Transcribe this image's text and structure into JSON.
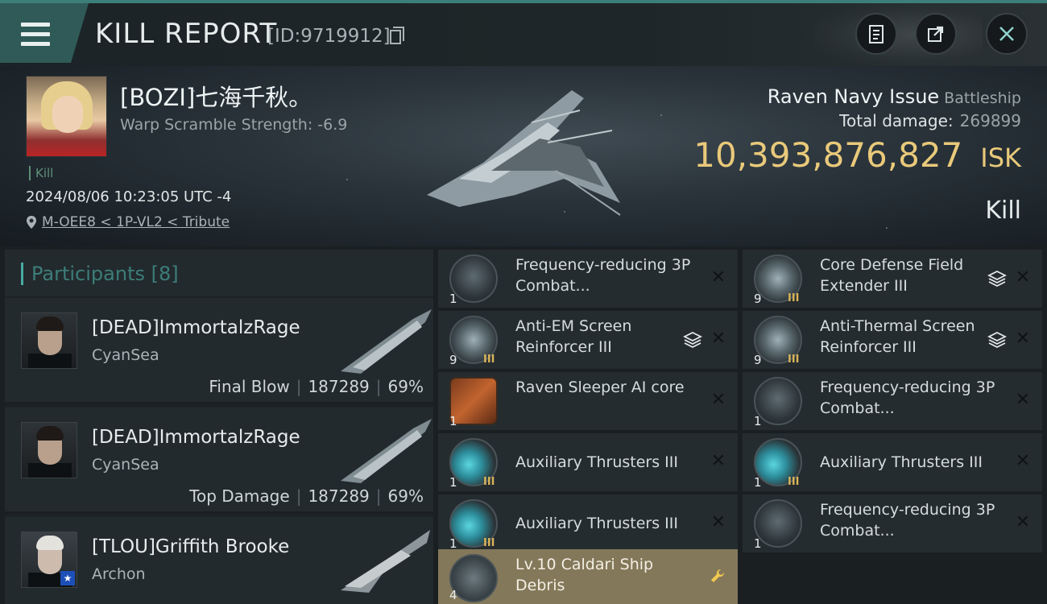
{
  "header": {
    "title": "KILL REPORT",
    "kill_id": "[ID:9719912]",
    "icons": [
      "menu-icon",
      "copy-icon",
      "clipboard-icon",
      "share-icon",
      "close-icon"
    ]
  },
  "victim": {
    "name": "[BOZI]七海千秋。",
    "warp_scramble": "Warp Scramble Strength: -6.9",
    "kill_tag": "Kill",
    "timestamp": "2024/08/06 10:23:05 UTC -4",
    "location": "M-OEE8 < 1P-VL2 < Tribute",
    "ship_name": "Raven Navy Issue",
    "ship_class": "Battleship",
    "total_damage_label": "Total damage:",
    "total_damage_value": "269899",
    "isk_value": "10,393,876,827",
    "isk_unit": "ISK",
    "result": "Kill"
  },
  "participants": {
    "title": "Participants",
    "count": "[8]",
    "rows": [
      {
        "name": "[DEAD]ImmortalzRage",
        "corp": "CyanSea",
        "role": "Final Blow",
        "damage": "187289",
        "percent": "69%"
      },
      {
        "name": "[DEAD]ImmortalzRage",
        "corp": "CyanSea",
        "role": "Top Damage",
        "damage": "187289",
        "percent": "69%"
      },
      {
        "name": "[TLOU]Griffith Brooke",
        "corp": "Archon",
        "role": "",
        "damage": "",
        "percent": ""
      }
    ]
  },
  "items": [
    {
      "name": "Frequency-reducing 3P Combat...",
      "qty": "1",
      "tier": "",
      "icon": "scope",
      "stack": false
    },
    {
      "name": "Core Defense Field Extender III",
      "qty": "9",
      "tier": "III",
      "icon": "shield",
      "stack": true
    },
    {
      "name": "Anti-EM Screen Reinforcer III",
      "qty": "9",
      "tier": "III",
      "icon": "shield",
      "stack": true
    },
    {
      "name": "Anti-Thermal Screen Reinforcer III",
      "qty": "9",
      "tier": "III",
      "icon": "shield",
      "stack": true
    },
    {
      "name": "Raven Sleeper AI core",
      "qty": "1",
      "tier": "",
      "icon": "orange",
      "stack": false
    },
    {
      "name": "Frequency-reducing 3P Combat...",
      "qty": "1",
      "tier": "",
      "icon": "scope",
      "stack": false
    },
    {
      "name": "Auxiliary Thrusters III",
      "qty": "1",
      "tier": "III",
      "icon": "cyan",
      "stack": false
    },
    {
      "name": "Auxiliary Thrusters III",
      "qty": "1",
      "tier": "III",
      "icon": "cyan",
      "stack": false
    },
    {
      "name": "Auxiliary Thrusters III",
      "qty": "1",
      "tier": "III",
      "icon": "cyan",
      "stack": false
    },
    {
      "name": "Frequency-reducing 3P Combat...",
      "qty": "1",
      "tier": "",
      "icon": "scope",
      "stack": false
    },
    {
      "name": "Lv.10 Caldari Ship Debris",
      "qty": "4",
      "tier": "",
      "icon": "debris",
      "stack": false,
      "highlight": true
    }
  ],
  "colors": {
    "accent": "#4ba9a3",
    "isk_gold": "#e9c97a",
    "highlight_item": "#84785a"
  }
}
